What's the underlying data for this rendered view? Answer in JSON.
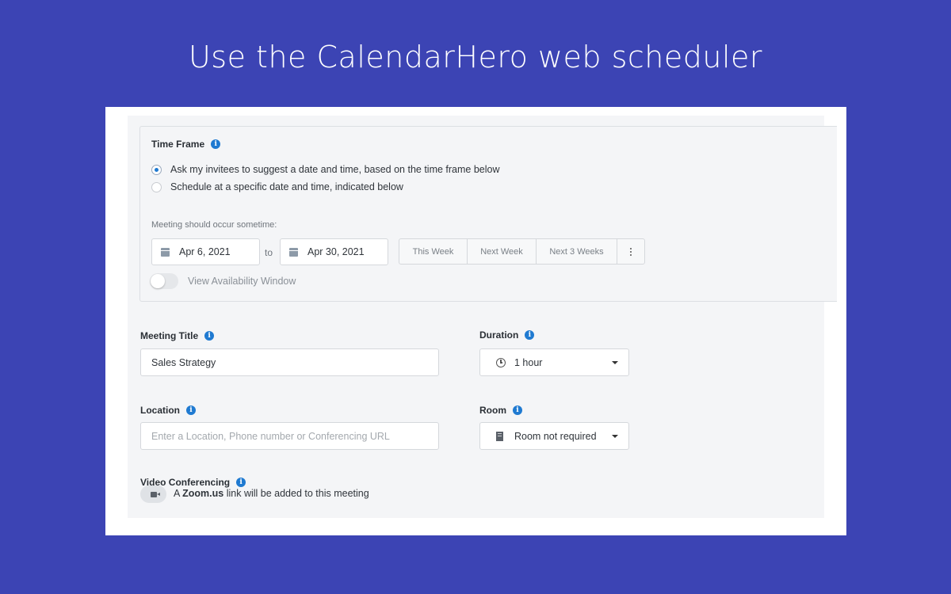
{
  "headline": "Use the CalendarHero web scheduler",
  "time_frame": {
    "label": "Time Frame",
    "options": [
      {
        "label": "Ask my invitees to suggest a date and time, based on the time frame below",
        "selected": true
      },
      {
        "label": "Schedule at a specific date and time, indicated below",
        "selected": false
      }
    ],
    "range_label": "Meeting should occur sometime:",
    "start_date": "Apr 6, 2021",
    "to": "to",
    "end_date": "Apr 30, 2021",
    "quick_ranges": [
      "This Week",
      "Next Week",
      "Next 3 Weeks"
    ],
    "availability_toggle": {
      "label": "View Availability Window",
      "on": false
    }
  },
  "meeting_title": {
    "label": "Meeting Title",
    "value": "Sales Strategy"
  },
  "duration": {
    "label": "Duration",
    "value": "1 hour"
  },
  "location": {
    "label": "Location",
    "value": "",
    "placeholder": "Enter a Location, Phone number or Conferencing URL"
  },
  "room": {
    "label": "Room",
    "value": "Room not required"
  },
  "video": {
    "label": "Video Conferencing",
    "text_prefix": "A",
    "provider": "Zoom.us",
    "text_suffix": "link will be added to this meeting"
  },
  "colors": {
    "background": "#3c44b4",
    "accent": "#1f7ad1",
    "panel": "#f4f5f7"
  },
  "icons": {
    "info": "info-icon",
    "calendar": "calendar-icon",
    "clock": "clock-icon",
    "building": "building-icon",
    "video": "video-camera-icon"
  }
}
